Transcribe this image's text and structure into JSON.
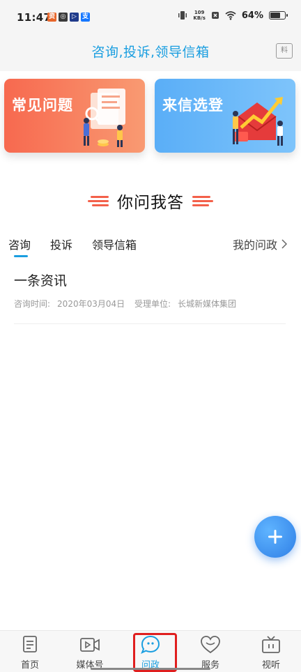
{
  "status_bar": {
    "time": "11:47",
    "net_speed_value": "109",
    "net_speed_unit": "KB/s",
    "battery_percent": "64%",
    "battery_level": 0.64,
    "app_icons": [
      {
        "name": "app-icon-1",
        "glyph": "资",
        "color": "#e8662a"
      },
      {
        "name": "app-icon-2",
        "glyph": "◎",
        "color": "#3a3a3a"
      },
      {
        "name": "app-icon-3",
        "glyph": "▷",
        "color": "#1f3a8a"
      },
      {
        "name": "app-icon-4",
        "glyph": "支",
        "color": "#1677ff"
      }
    ]
  },
  "header": {
    "title": "咨询,投诉,领导信箱",
    "action_icon_glyph": "料"
  },
  "banners": {
    "faq": {
      "title": "常见问题",
      "color": "#f7694f"
    },
    "letters": {
      "title": "来信选登",
      "color": "#5aaef7"
    }
  },
  "section": {
    "title": "你问我答"
  },
  "tabs": {
    "items": [
      {
        "label": "咨询"
      },
      {
        "label": "投诉"
      },
      {
        "label": "领导信箱"
      }
    ],
    "my_asks": "我的问政"
  },
  "list": [
    {
      "title": "一条资讯",
      "time_label": "咨询时间:",
      "time_value": "2020年03月04日",
      "unit_label": "受理单位:",
      "unit_value": "长城新媒体集团"
    }
  ],
  "bottom_nav": {
    "items": [
      {
        "label": "首页"
      },
      {
        "label": "媒体号"
      },
      {
        "label": "问政"
      },
      {
        "label": "服务"
      },
      {
        "label": "视听"
      }
    ]
  },
  "colors": {
    "accent": "#1a9ee0",
    "highlight_box": "#e01e1e",
    "fab": "#2f7fe6"
  }
}
